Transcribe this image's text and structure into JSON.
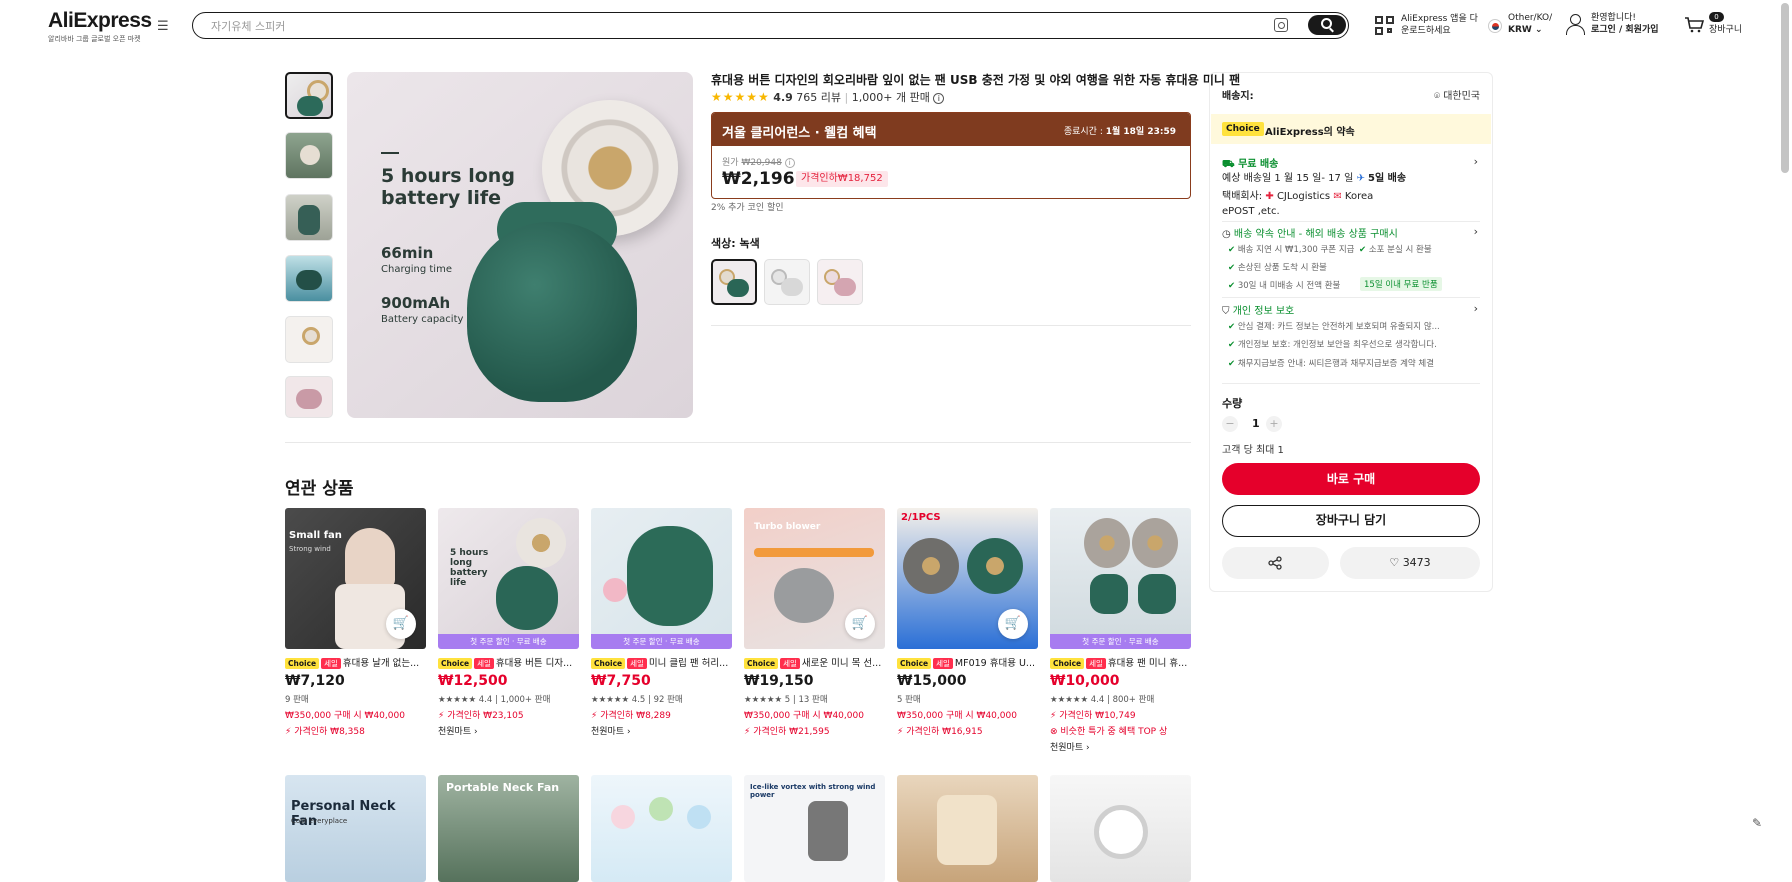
{
  "header": {
    "logo": "AliExpress",
    "logo_sub": "알리바바 그룹 글로벌 오픈 마켓",
    "search_placeholder": "자기유체 스피커",
    "app_line1": "AliExpress 앱을 다",
    "app_line2": "운로드하세요",
    "locale_line1": "Other/KO/",
    "locale_line2": "KRW",
    "welcome": "환영합니다!",
    "login": "로그인 / 회원가입",
    "cart_count": "0",
    "cart_label": "장바구니"
  },
  "product": {
    "title": "휴대용 버튼 디자인의 회오리바람 잎이 없는 팬 USB 충전 가정 및 야외 여행을 위한 자동 휴대용 미니 팬",
    "stars": "★★★★★",
    "rating": "4.9",
    "reviews": "765 리뷰",
    "sold": "1,000+ 개 판매",
    "image_text": {
      "headline1": "5 hours long",
      "headline2": "battery life",
      "spec1_value": "66min",
      "spec1_label": "Charging time",
      "spec2_value": "900mAh",
      "spec2_label": "Battery capacity"
    },
    "promo_title": "겨울 클리어런스 · 웰컴 혜택",
    "promo_end_label": "종료시간 :",
    "promo_end": "1월 18일 23:59",
    "orig_label": "원가",
    "orig_price": "₩20,948",
    "price": "₩2,196",
    "discount": "가격인하₩18,752",
    "coin_note": "2% 추가 코인 할인",
    "color_label": "색상: 녹색"
  },
  "panel": {
    "ship_to": "배송지:",
    "country": "대한민국",
    "choice_tag": "Choice",
    "choice_promise": "AliExpress의 약속",
    "free_shipping": "무료 배송",
    "eta": "예상 배송일 1 월 15 일- 17 일",
    "eta_days": "5일 배송",
    "carrier_prefix": "택배회사:",
    "carrier1": "CJLogistics",
    "carrier2": "Korea",
    "carrier3": "ePOST ,etc.",
    "guarantee_title": "배송 약속 안내 - 해외 배송 상품 구매시",
    "g1": "배송 지연 시 ₩1,300 쿠폰 지급",
    "g2": "소포 분실 시 환불",
    "g3": "손상된 상품 도착 시 환불",
    "g4": "30일 내 미배송 시 전액 환불",
    "g4_tag": "15일 이내 무료 반품",
    "privacy_title": "개인 정보 보호",
    "p1": "안심 결제: 카드 정보는 안전하게 보호되며 유출되지 않...",
    "p2": "개인정보 보호: 개인정보 보안을 최우선으로 생각합니다.",
    "p3": "채무지급보증 안내: 씨티은행과 채무지급보증 계약 체결",
    "qty_label": "수량",
    "qty_minus": "−",
    "qty_plus": "+",
    "qty_value": "1",
    "max_note": "고객 당 최대 1",
    "buy_now": "바로 구매",
    "add_cart": "장바구니 담기",
    "wishlist_count": "3473"
  },
  "related": {
    "title": "연관 상품",
    "items": [
      {
        "choice": "Choice",
        "sale": "세일",
        "name": "휴대용 날개 없는...",
        "price": "₩7,120",
        "meta": "9 판매",
        "red1": "₩350,000 구매 시 ₩40,000",
        "red2": "가격인하 ₩8,358",
        "link": "",
        "banner": "",
        "img_text1": "Small fan",
        "img_text2": "Strong wind"
      },
      {
        "choice": "Choice",
        "sale": "세일",
        "name": "휴대용 버튼 디자...",
        "price": "₩12,500",
        "meta": "★★★★★ 4.4 | 1,000+ 판매",
        "red1": "가격인하 ₩23,105",
        "red2": "",
        "link": "천원마트 ›",
        "banner": "첫 주문 할인 · 무료 배송",
        "img_text1": "5 hours long",
        "img_text2": "battery life"
      },
      {
        "choice": "Choice",
        "sale": "세일",
        "name": "미니 클립 팬 허리...",
        "price": "₩7,750",
        "meta": "★★★★★ 4.5 | 92 판매",
        "red1": "가격인하 ₩8,289",
        "red2": "",
        "link": "천원마트 ›",
        "banner": "첫 주문 할인 · 무료 배송",
        "img_text1": "",
        "img_text2": ""
      },
      {
        "choice": "Choice",
        "sale": "세일",
        "name": "새로운 미니 목 선...",
        "price": "₩19,150",
        "meta": "★★★★★ 5 | 13 판매",
        "red1": "₩350,000 구매 시 ₩40,000",
        "red2": "가격인하 ₩21,595",
        "link": "",
        "banner": "",
        "img_text1": "Turbo blower",
        "img_text2": ""
      },
      {
        "choice": "Choice",
        "sale": "세일",
        "name": "MF019 휴대용 U...",
        "price": "₩15,000",
        "meta": "5 판매",
        "red1": "₩350,000 구매 시 ₩40,000",
        "red2": "가격인하 ₩16,915",
        "link": "",
        "banner": "",
        "img_text1": "2/1PCS",
        "img_text2": ""
      },
      {
        "choice": "Choice",
        "sale": "세일",
        "name": "휴대용 팬 미니 휴...",
        "price": "₩10,000",
        "meta": "★★★★★ 4.4 | 800+ 판매",
        "red1": "가격인하 ₩10,749",
        "red2": "비슷한 특가 중 혜택 TOP 상",
        "link": "천원마트 ›",
        "banner": "첫 주문 할인 · 무료 배송",
        "img_text1": "",
        "img_text2": ""
      }
    ],
    "row2": [
      {
        "img_text1": "Personal Neck Fan",
        "img_text2": "Cool everyplace"
      },
      {
        "img_text1": "Portable Neck Fan",
        "img_text2": ""
      },
      {
        "img_text1": "",
        "img_text2": ""
      },
      {
        "img_text1": "Ice-like vortex with strong wind power",
        "img_text2": ""
      },
      {
        "img_text1": "",
        "img_text2": ""
      },
      {
        "img_text1": "",
        "img_text2": ""
      }
    ]
  }
}
